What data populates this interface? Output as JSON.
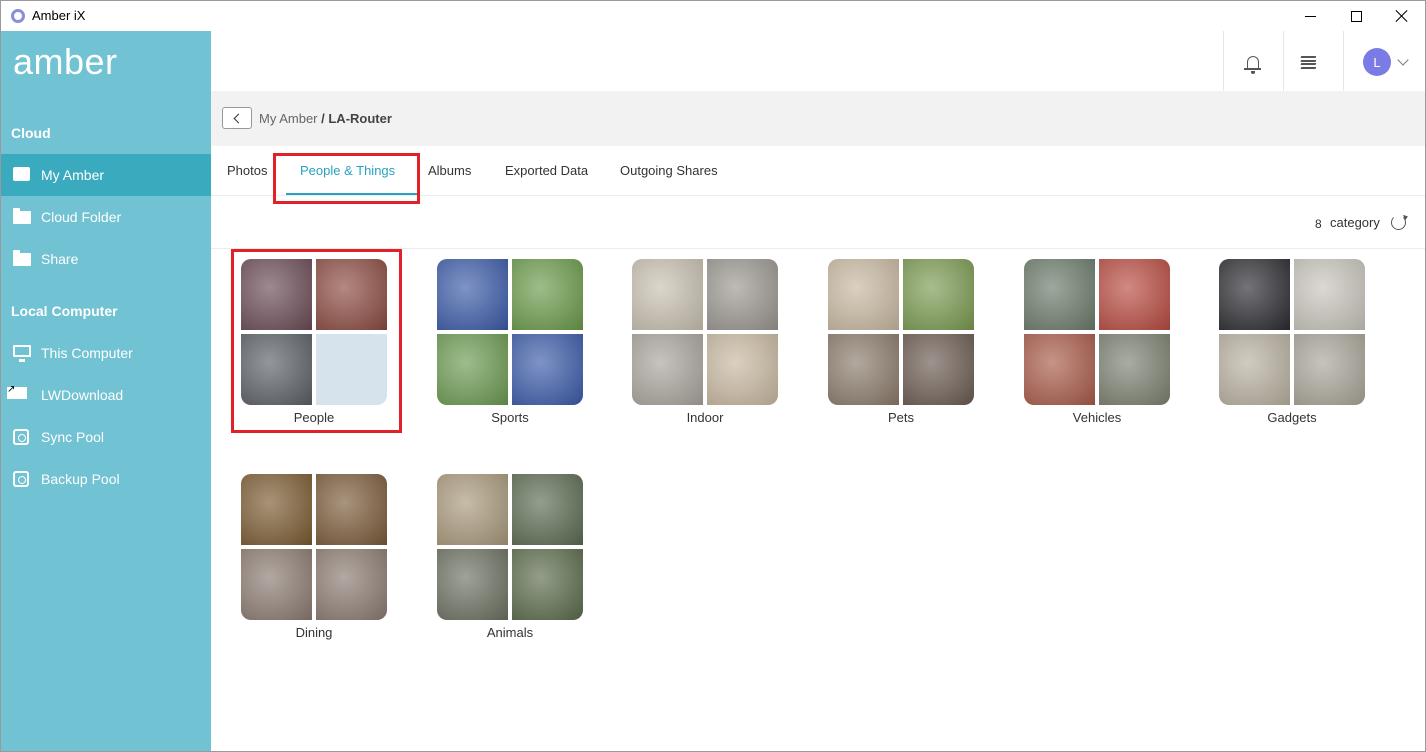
{
  "window": {
    "title": "Amber iX"
  },
  "sidebar": {
    "logo": "amber",
    "sections": [
      {
        "title": "Cloud"
      },
      {
        "title": "Local Computer"
      }
    ],
    "items": [
      {
        "label": "My Amber",
        "active": true
      },
      {
        "label": "Cloud Folder"
      },
      {
        "label": "Share"
      },
      {
        "label": "This Computer"
      },
      {
        "label": "LWDownload"
      },
      {
        "label": "Sync Pool"
      },
      {
        "label": "Backup Pool"
      }
    ]
  },
  "header": {
    "avatar_initial": "L"
  },
  "breadcrumb": {
    "root": "My Amber",
    "separator": " / ",
    "current": "LA-Router"
  },
  "tabs": [
    {
      "label": "Photos"
    },
    {
      "label": "People & Things",
      "active": true
    },
    {
      "label": "Albums"
    },
    {
      "label": "Exported Data"
    },
    {
      "label": "Outgoing Shares"
    }
  ],
  "summary": {
    "count": "8",
    "label": "category"
  },
  "categories": [
    {
      "label": "People",
      "tiles": [
        "#6a4a55",
        "#8a4a40",
        "#5a5f66",
        "empty"
      ]
    },
    {
      "label": "Sports",
      "tiles": [
        "#3a5aa8",
        "#6a9a4a",
        "#6a9a50",
        "#3a5aa8"
      ]
    },
    {
      "label": "Indoor",
      "tiles": [
        "#c8c0b0",
        "#9a9690",
        "#a8a49c",
        "#c8b8a0"
      ]
    },
    {
      "label": "Pets",
      "tiles": [
        "#c8b8a0",
        "#7a9a50",
        "#8a7a6a",
        "#6a5a50"
      ]
    },
    {
      "label": "Vehicles",
      "tiles": [
        "#6a7a6a",
        "#b84a40",
        "#a85a48",
        "#7a8070"
      ]
    },
    {
      "label": "Gadgets",
      "tiles": [
        "#2a2a30",
        "#c8c4bc",
        "#b8b0a0",
        "#a8a498"
      ]
    },
    {
      "label": "Dining",
      "tiles": [
        "#7a5a30",
        "#7a5a38",
        "#8a7a70",
        "#8a7a70"
      ]
    },
    {
      "label": "Animals",
      "tiles": [
        "#a8987a",
        "#5a6a50",
        "#6a7060",
        "#5a6a4a"
      ]
    }
  ],
  "colors": {
    "sidebar": "#71c2d2",
    "sidebar_active": "#3aaabf",
    "accent": "#2aa0c0",
    "highlight": "#e02128"
  }
}
